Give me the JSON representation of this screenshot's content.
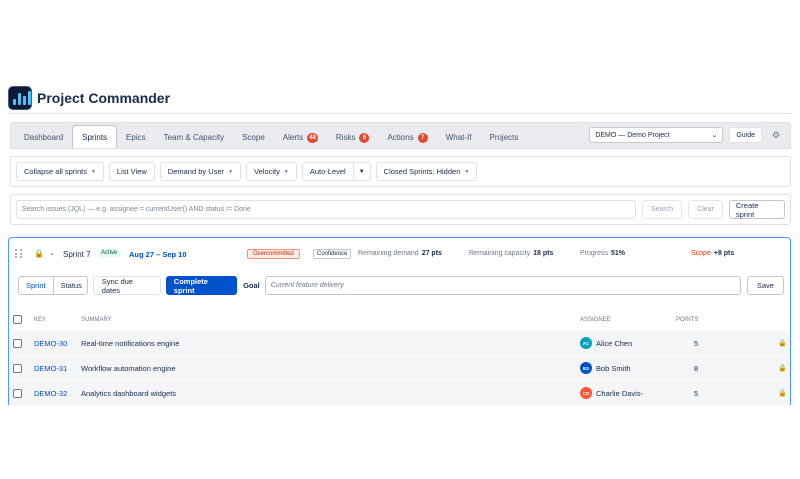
{
  "app": {
    "title": "Project Commander"
  },
  "tabs": [
    {
      "label": "Dashboard"
    },
    {
      "label": "Sprints",
      "active": true
    },
    {
      "label": "Epics"
    },
    {
      "label": "Team & Capacity"
    },
    {
      "label": "Scope"
    },
    {
      "label": "Alerts",
      "badge": "48"
    },
    {
      "label": "Risks",
      "badge": "6"
    },
    {
      "label": "Actions",
      "badge": "7"
    },
    {
      "label": "What-If"
    },
    {
      "label": "Projects"
    }
  ],
  "project_select": {
    "value": "DEMO — Demo Project"
  },
  "guide_label": "Guide",
  "toolbar": {
    "collapse": "Collapse all sprints",
    "list_view": "List View",
    "demand": "Demand by User",
    "velocity": "Velocity",
    "auto_level": "Auto-Level",
    "closed": "Closed Sprints: Hidden"
  },
  "search": {
    "placeholder": "Search issues (JQL) — e.g. assignee = currentUser() AND status != Done",
    "search_label": "Search",
    "clear_label": "Clear",
    "create_label": "Create sprint"
  },
  "sprint": {
    "name": "Sprint 7",
    "status": "Active",
    "dates": "Aug 27 – Sep 10",
    "overcommitted": "Overcommitted",
    "confidence": "Confidence",
    "remaining_demand_label": "Remaining demand",
    "remaining_demand": "27 pts",
    "remaining_capacity_label": "Remaining capacity",
    "remaining_capacity": "18 pts",
    "progress_label": "Progress",
    "progress": "51%",
    "scope_label": "Scope",
    "scope": "+8 pts",
    "view_sprint": "Sprint",
    "view_status": "Status",
    "sync_label": "Sync due dates",
    "complete_label": "Complete sprint",
    "goal_label": "Goal",
    "goal_placeholder": "Current feature delivery",
    "save_label": "Save"
  },
  "table": {
    "headers": {
      "key": "KEY",
      "summary": "SUMMARY",
      "assignee": "ASSIGNEE",
      "points": "POINTS"
    },
    "rows": [
      {
        "key": "DEMO-30",
        "summary": "Real-time notifications engine",
        "initials": "AC",
        "assignee": "Alice Chen",
        "points": "5",
        "color": "#00a3bf"
      },
      {
        "key": "DEMO-31",
        "summary": "Workflow automation engine",
        "initials": "BS",
        "assignee": "Bob Smith",
        "points": "8",
        "color": "#0052cc"
      },
      {
        "key": "DEMO-32",
        "summary": "Analytics dashboard widgets",
        "initials": "CD",
        "assignee": "Charlie Davis-",
        "points": "5",
        "color": "#ff5630"
      }
    ]
  }
}
